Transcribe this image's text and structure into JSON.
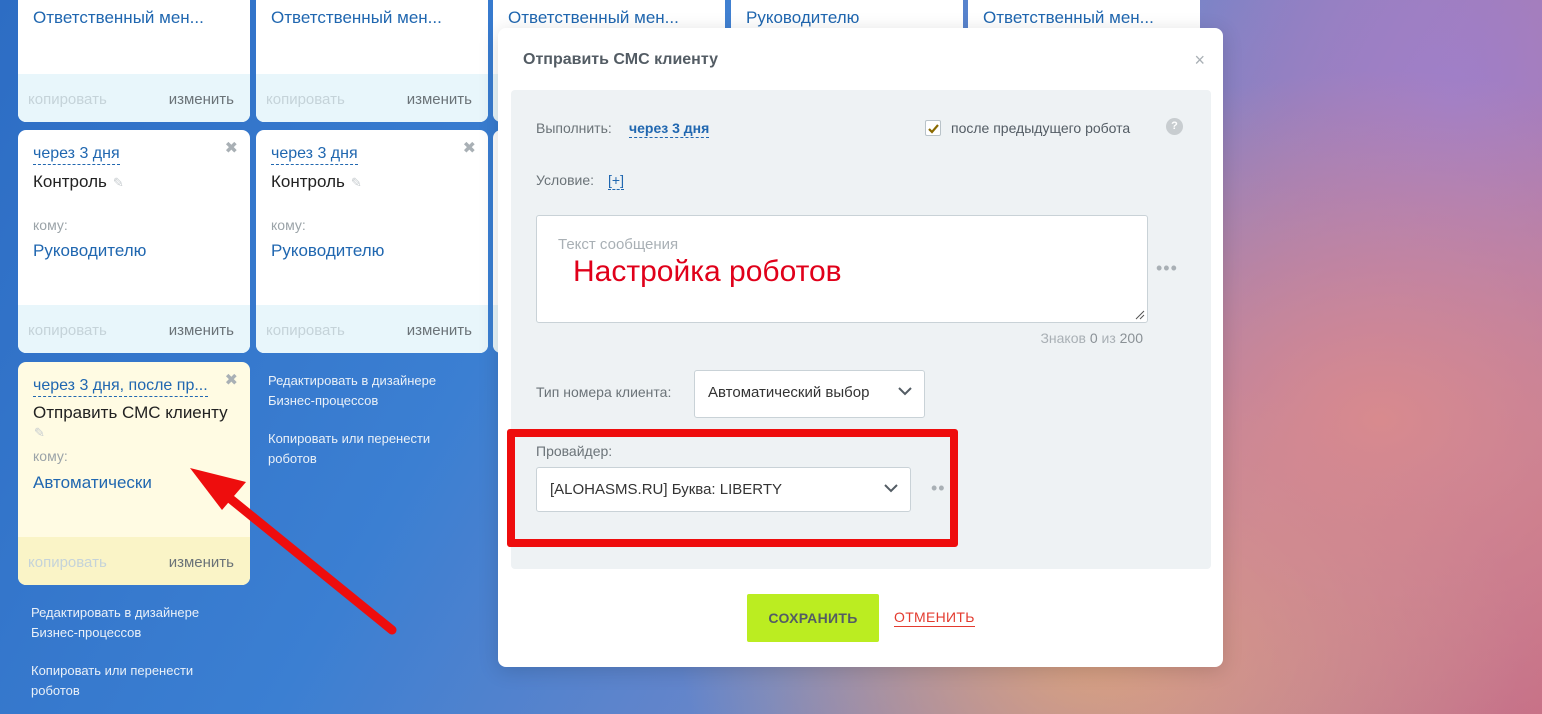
{
  "top_cards": [
    {
      "text": "Ответственный мен..."
    },
    {
      "text": "Ответственный мен..."
    },
    {
      "text": "Ответственный мен..."
    },
    {
      "text": "Руководителю"
    },
    {
      "text": "Ответственный мен..."
    }
  ],
  "card_actions": {
    "copy": "копировать",
    "edit": "изменить"
  },
  "control_cards": [
    {
      "delay": "через 3 дня",
      "title": "Контроль",
      "to_label": "кому:",
      "to_value": "Руководителю"
    },
    {
      "delay": "через 3 дня",
      "title": "Контроль",
      "to_label": "кому:",
      "to_value": "Руководителю"
    }
  ],
  "sms_card": {
    "delay": "через 3 дня, после пр...",
    "title": "Отправить СМС клиенту",
    "to_label": "кому:",
    "to_value": "Автоматически"
  },
  "links": {
    "designer_line1": "Редактировать в дизайнере",
    "designer_line2": "Бизнес-процессов",
    "copy_line1": "Копировать или перенести",
    "copy_line2": "роботов"
  },
  "modal": {
    "title": "Отправить СМС клиенту",
    "close": "×",
    "execute_label": "Выполнить:",
    "execute_value": "через 3 дня",
    "after_previous_label": "после предыдущего робота",
    "after_previous_checked": true,
    "help": "?",
    "condition_label": "Условие:",
    "condition_add": "[+]",
    "message_placeholder": "Текст сообщения",
    "counter_prefix": "Знаков",
    "counter_count": "0",
    "counter_mid": "из",
    "counter_max": "200",
    "number_type_label": "Тип номера клиента:",
    "number_type_value": "Автоматический выбор",
    "provider_label": "Провайдер:",
    "provider_value": "[ALOHASMS.RU] Буква: LIBERTY",
    "save_button": "СОХРАНИТЬ",
    "cancel_button": "ОТМЕНИТЬ"
  },
  "annotation": {
    "heading": "Настройка роботов",
    "highlight_color": "#ee0d0d"
  },
  "colors": {
    "accent_link": "#2067b0",
    "save_button": "#bbed21",
    "cancel_text": "#e33b2f"
  }
}
